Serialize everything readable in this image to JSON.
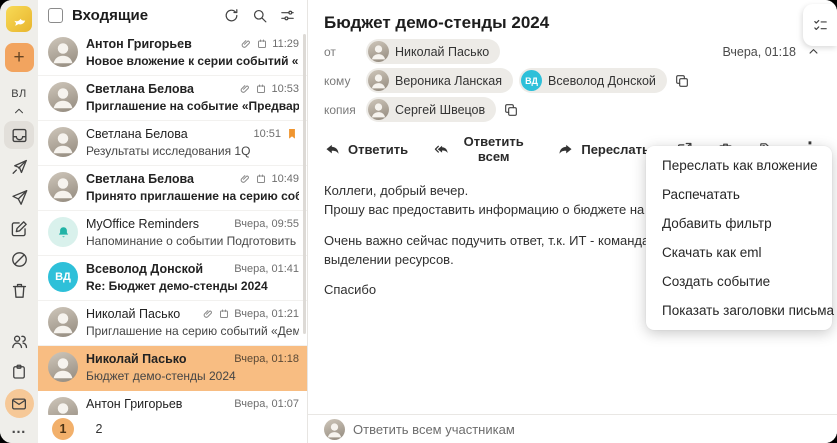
{
  "icons": {
    "plus": "+",
    "kebab": "⋮",
    "more": "…"
  },
  "colors": {
    "accent_orange": "#F2A45F",
    "selected_row": "#F8BD82",
    "pager_current": "#F2B06B",
    "badge_cyan": "#2EC0D9",
    "flag_orange": "#F0952F",
    "reminder_teal": "#22B3A6"
  },
  "sidebar": {
    "user_initials": "ВЛ"
  },
  "mail_list": {
    "title": "Входящие",
    "pagination": {
      "current": "1",
      "next": "2"
    },
    "items": [
      {
        "sender": "Антон Григорьев",
        "subject": "Новое вложение к серии событий «Аналити…",
        "time": "11:29",
        "unread": true,
        "attach": true,
        "event": true,
        "avatar": {
          "type": "photo"
        }
      },
      {
        "sender": "Светлана Белова",
        "subject": "Приглашение на событие «Предварительно…",
        "time": "10:53",
        "unread": true,
        "attach": true,
        "event": true,
        "avatar": {
          "type": "photo"
        }
      },
      {
        "sender": "Светлана Белова",
        "subject": "Результаты исследования 1Q",
        "time": "10:51",
        "flagged": true,
        "avatar": {
          "type": "photo"
        }
      },
      {
        "sender": "Светлана Белова",
        "subject": "Принято приглашение на серию событий «…",
        "time": "10:49",
        "unread": true,
        "attach": true,
        "event": true,
        "avatar": {
          "type": "photo"
        }
      },
      {
        "sender": "MyOffice Reminders",
        "subject": "Напоминание о событии Подготовить отчет…",
        "time": "Вчера, 09:55",
        "avatar": {
          "type": "bell"
        }
      },
      {
        "sender": "Всеволод Донской",
        "subject": "Re: Бюджет демо-стенды 2024",
        "time": "Вчера, 01:41",
        "unread": true,
        "avatar": {
          "type": "initials",
          "initials": "ВД"
        }
      },
      {
        "sender": "Николай Пасько",
        "subject": "Приглашение на серию событий «Демо стен…",
        "time": "Вчера, 01:21",
        "attach": true,
        "event": true,
        "avatar": {
          "type": "photo"
        }
      },
      {
        "sender": "Николай Пасько",
        "subject": "Бюджет демо-стенды 2024",
        "time": "Вчера, 01:18",
        "selected": true,
        "avatar": {
          "type": "photo"
        }
      },
      {
        "sender": "Антон Григорьев",
        "subject": "",
        "time": "Вчера, 01:07",
        "avatar": {
          "type": "photo"
        }
      }
    ]
  },
  "message": {
    "subject": "Бюджет демо-стенды 2024",
    "date": "Вчера, 01:18",
    "from_label": "от",
    "from": {
      "name": "Николай Пасько"
    },
    "to_label": "кому",
    "to": [
      {
        "name": "Вероника Ланская",
        "avatar": {
          "type": "photo"
        }
      },
      {
        "name": "Всеволод Донской",
        "avatar": {
          "type": "initials",
          "initials": "ВД"
        }
      }
    ],
    "cc_label": "копия",
    "cc": [
      {
        "name": "Сергей Швецов",
        "avatar": {
          "type": "photo"
        }
      }
    ],
    "toolbar": {
      "reply": "Ответить",
      "reply_all": "Ответить всем",
      "forward": "Переслать"
    },
    "body_paragraphs": [
      "Коллеги, добрый вечер.\nПрошу вас предоставить информацию о бюджете на наши демонстраци",
      "Очень важно сейчас подучить ответ, т.к. ИТ - команда Всеволода, уже\nвыделении ресурсов.",
      "Спасибо"
    ],
    "reply_placeholder": "Ответить всем участникам"
  },
  "context_menu": {
    "items": [
      "Переслать как вложение",
      "Распечатать",
      "Добавить фильтр",
      "Скачать как eml",
      "Создать событие",
      "Показать заголовки письма"
    ]
  }
}
